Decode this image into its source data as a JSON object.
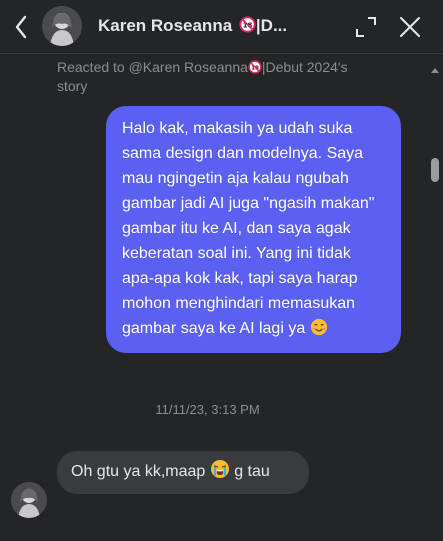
{
  "header": {
    "contact_name": "Karen Roseanna",
    "name_suffix": "|D...",
    "age_badge_icon": "no-under-18-icon",
    "back_icon": "chevron-left-icon",
    "expand_icon": "expand-icon",
    "close_icon": "close-icon"
  },
  "thread": {
    "reaction_note_prefix": "Reacted to @Karen Roseanna",
    "reaction_note_suffix": "|Debut 2024's story",
    "outgoing_message": "Halo kak, makasih ya udah suka sama design dan modelnya. Saya mau ngingetin aja kalau ngubah gambar jadi AI juga \"ngasih makan\" gambar itu ke AI, dan saya agak keberatan soal ini. Yang ini tidak apa-apa kok kak, tapi saya harap mohon menghindari memasukan gambar saya ke AI lagi ya",
    "outgoing_emoji": "smiling-face-icon",
    "timestamp": "11/11/23, 3:13 PM",
    "incoming_message_part1": "Oh gtu ya kk,maap",
    "incoming_emoji": "crying-face-icon",
    "incoming_message_part2": "g tau"
  },
  "colors": {
    "background": "#242526",
    "outgoing_bubble": "#5b5ff2",
    "incoming_bubble": "#3a3b3c",
    "muted_text": "#8a8d91"
  }
}
